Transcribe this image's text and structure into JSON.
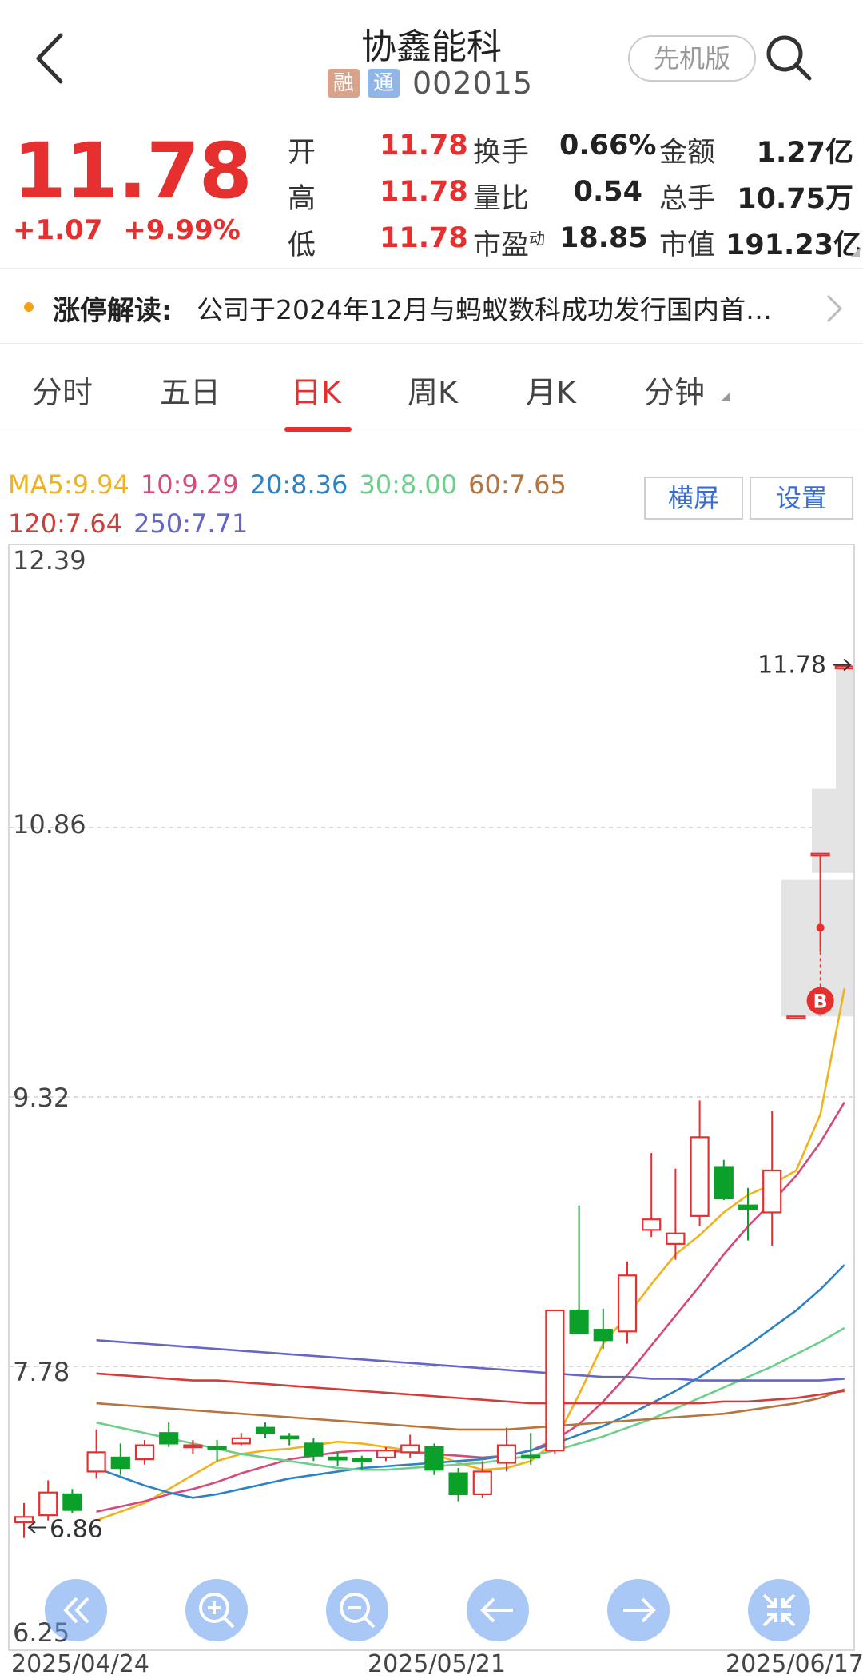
{
  "header": {
    "title": "协鑫能科",
    "tags": [
      "融",
      "通"
    ],
    "code": "002015",
    "vip_label": "先机版"
  },
  "quote": {
    "price": "11.78",
    "change": "+1.07",
    "change_pct": "+9.99%",
    "rows": [
      [
        {
          "l": "开",
          "v": "11.78"
        },
        {
          "l": "换手",
          "v": "0.66%"
        },
        {
          "l": "金额",
          "v": "1.27亿"
        }
      ],
      [
        {
          "l": "高",
          "v": "11.78"
        },
        {
          "l": "量比",
          "v": "0.54"
        },
        {
          "l": "总手",
          "v": "10.75万"
        }
      ],
      [
        {
          "l": "低",
          "v": "11.78"
        },
        {
          "l": "市盈",
          "sup": "动",
          "v": "18.85"
        },
        {
          "l": "市值",
          "v": "191.23亿"
        }
      ]
    ]
  },
  "banner": {
    "label": "涨停解读:",
    "text": "公司于2024年12月与蚂蚁数科成功发行国内首…"
  },
  "tabs": [
    "分时",
    "五日",
    "日K",
    "周K",
    "月K",
    "分钟"
  ],
  "active_tab": 2,
  "ma": {
    "row1": [
      {
        "label": "MA5:9.94",
        "color": "#f0b31d"
      },
      {
        "label": "10:9.29",
        "color": "#d6497b"
      },
      {
        "label": "20:8.36",
        "color": "#2b83c6"
      },
      {
        "label": "30:8.00",
        "color": "#6ccf8a"
      },
      {
        "label": "60:7.65",
        "color": "#b8743d"
      }
    ],
    "row2": [
      {
        "label": "120:7.64",
        "color": "#d63b3b"
      },
      {
        "label": "250:7.71",
        "color": "#6466c8"
      }
    ]
  },
  "buttons": {
    "landscape": "横屏",
    "settings": "设置"
  },
  "chart_data": {
    "type": "candlestick",
    "ylim": [
      6.25,
      12.39
    ],
    "y_ticks": [
      "12.39",
      "10.86",
      "9.32",
      "7.78",
      "6.25"
    ],
    "x_labels": [
      "2025/04/24",
      "2025/05/21",
      "2025/06/17"
    ],
    "last_price_label": "11.78",
    "min_label": "6.86",
    "buy_marker": "B",
    "colors": {
      "up": "#e5302f",
      "down": "#0aa02a"
    },
    "candles": [
      {
        "o": 6.89,
        "h": 7.0,
        "l": 6.8,
        "c": 6.92
      },
      {
        "o": 6.93,
        "h": 7.13,
        "l": 6.9,
        "c": 7.06
      },
      {
        "o": 7.05,
        "h": 7.08,
        "l": 6.94,
        "c": 6.96
      },
      {
        "o": 7.18,
        "h": 7.42,
        "l": 7.14,
        "c": 7.29
      },
      {
        "o": 7.26,
        "h": 7.34,
        "l": 7.16,
        "c": 7.2
      },
      {
        "o": 7.25,
        "h": 7.36,
        "l": 7.22,
        "c": 7.33
      },
      {
        "o": 7.4,
        "h": 7.46,
        "l": 7.32,
        "c": 7.34
      },
      {
        "o": 7.33,
        "h": 7.36,
        "l": 7.28,
        "c": 7.33
      },
      {
        "o": 7.32,
        "h": 7.36,
        "l": 7.24,
        "c": 7.31
      },
      {
        "o": 7.34,
        "h": 7.4,
        "l": 7.33,
        "c": 7.37
      },
      {
        "o": 7.43,
        "h": 7.46,
        "l": 7.37,
        "c": 7.4
      },
      {
        "o": 7.38,
        "h": 7.4,
        "l": 7.33,
        "c": 7.37
      },
      {
        "o": 7.34,
        "h": 7.37,
        "l": 7.24,
        "c": 7.27
      },
      {
        "o": 7.26,
        "h": 7.29,
        "l": 7.21,
        "c": 7.25
      },
      {
        "o": 7.25,
        "h": 7.27,
        "l": 7.19,
        "c": 7.24
      },
      {
        "o": 7.26,
        "h": 7.32,
        "l": 7.24,
        "c": 7.3
      },
      {
        "o": 7.29,
        "h": 7.39,
        "l": 7.26,
        "c": 7.33
      },
      {
        "o": 7.32,
        "h": 7.34,
        "l": 7.16,
        "c": 7.19
      },
      {
        "o": 7.17,
        "h": 7.2,
        "l": 7.01,
        "c": 7.05
      },
      {
        "o": 7.05,
        "h": 7.24,
        "l": 7.03,
        "c": 7.18
      },
      {
        "o": 7.23,
        "h": 7.43,
        "l": 7.18,
        "c": 7.33
      },
      {
        "o": 7.27,
        "h": 7.4,
        "l": 7.22,
        "c": 7.26
      },
      {
        "o": 7.3,
        "h": 8.1,
        "l": 7.28,
        "c": 8.1
      },
      {
        "o": 8.1,
        "h": 8.7,
        "l": 7.98,
        "c": 7.97
      },
      {
        "o": 7.99,
        "h": 8.11,
        "l": 7.88,
        "c": 7.93
      },
      {
        "o": 7.98,
        "h": 8.38,
        "l": 7.91,
        "c": 8.3
      },
      {
        "o": 8.56,
        "h": 9.0,
        "l": 8.52,
        "c": 8.62
      },
      {
        "o": 8.48,
        "h": 8.91,
        "l": 8.39,
        "c": 8.54
      },
      {
        "o": 8.64,
        "h": 9.3,
        "l": 8.58,
        "c": 9.09
      },
      {
        "o": 8.92,
        "h": 8.96,
        "l": 8.73,
        "c": 8.74
      },
      {
        "o": 8.7,
        "h": 8.8,
        "l": 8.5,
        "c": 8.68
      },
      {
        "o": 8.66,
        "h": 9.24,
        "l": 8.47,
        "c": 8.9
      },
      {
        "o": 9.78,
        "h": 9.78,
        "l": 9.78,
        "c": 9.78
      },
      {
        "o": 10.71,
        "h": 10.71,
        "l": 10.15,
        "c": 10.71
      },
      {
        "o": 11.78,
        "h": 11.78,
        "l": 11.78,
        "c": 11.78
      }
    ],
    "ma_series": [
      {
        "color": "#f0b31d",
        "values": [
          6.9,
          6.95,
          7.0,
          7.08,
          7.16,
          7.24,
          7.28,
          7.3,
          7.31,
          7.33,
          7.35,
          7.34,
          7.32,
          7.3,
          7.28,
          7.23,
          7.19,
          7.2,
          7.24,
          7.35,
          7.62,
          7.91,
          8.07,
          8.25,
          8.42,
          8.53,
          8.66,
          8.76,
          8.82,
          8.9,
          9.22,
          9.94
        ]
      },
      {
        "color": "#d6497b",
        "values": [
          6.95,
          6.98,
          7.01,
          7.05,
          7.08,
          7.12,
          7.17,
          7.21,
          7.25,
          7.27,
          7.29,
          7.3,
          7.3,
          7.29,
          7.28,
          7.27,
          7.26,
          7.27,
          7.3,
          7.36,
          7.45,
          7.58,
          7.73,
          7.9,
          8.07,
          8.24,
          8.42,
          8.58,
          8.72,
          8.87,
          9.06,
          9.29
        ]
      },
      {
        "color": "#2b83c6",
        "values": [
          7.2,
          7.15,
          7.1,
          7.06,
          7.03,
          7.05,
          7.08,
          7.11,
          7.14,
          7.16,
          7.18,
          7.2,
          7.21,
          7.22,
          7.23,
          7.24,
          7.25,
          7.27,
          7.3,
          7.34,
          7.39,
          7.44,
          7.5,
          7.57,
          7.64,
          7.72,
          7.81,
          7.9,
          8.0,
          8.1,
          8.22,
          8.36
        ]
      },
      {
        "color": "#6ccf8a",
        "values": [
          7.46,
          7.43,
          7.4,
          7.37,
          7.34,
          7.31,
          7.28,
          7.26,
          7.24,
          7.22,
          7.2,
          7.19,
          7.19,
          7.2,
          7.21,
          7.22,
          7.23,
          7.25,
          7.27,
          7.3,
          7.34,
          7.38,
          7.43,
          7.48,
          7.54,
          7.6,
          7.66,
          7.72,
          7.78,
          7.85,
          7.92,
          8.0
        ]
      },
      {
        "color": "#b8743d",
        "values": [
          7.57,
          7.56,
          7.55,
          7.54,
          7.53,
          7.52,
          7.51,
          7.5,
          7.49,
          7.48,
          7.47,
          7.46,
          7.45,
          7.44,
          7.43,
          7.42,
          7.42,
          7.42,
          7.43,
          7.44,
          7.45,
          7.46,
          7.47,
          7.48,
          7.49,
          7.5,
          7.51,
          7.53,
          7.55,
          7.57,
          7.6,
          7.65
        ]
      },
      {
        "color": "#d63b3b",
        "values": [
          7.74,
          7.73,
          7.72,
          7.71,
          7.7,
          7.7,
          7.69,
          7.68,
          7.67,
          7.66,
          7.65,
          7.64,
          7.63,
          7.62,
          7.61,
          7.6,
          7.59,
          7.58,
          7.57,
          7.57,
          7.57,
          7.57,
          7.57,
          7.57,
          7.57,
          7.57,
          7.58,
          7.58,
          7.59,
          7.6,
          7.62,
          7.64
        ]
      },
      {
        "color": "#6466c8",
        "values": [
          7.93,
          7.92,
          7.91,
          7.9,
          7.89,
          7.88,
          7.87,
          7.86,
          7.85,
          7.84,
          7.83,
          7.82,
          7.81,
          7.8,
          7.79,
          7.78,
          7.77,
          7.76,
          7.75,
          7.74,
          7.73,
          7.72,
          7.72,
          7.71,
          7.71,
          7.7,
          7.7,
          7.7,
          7.7,
          7.7,
          7.7,
          7.71
        ]
      }
    ]
  }
}
